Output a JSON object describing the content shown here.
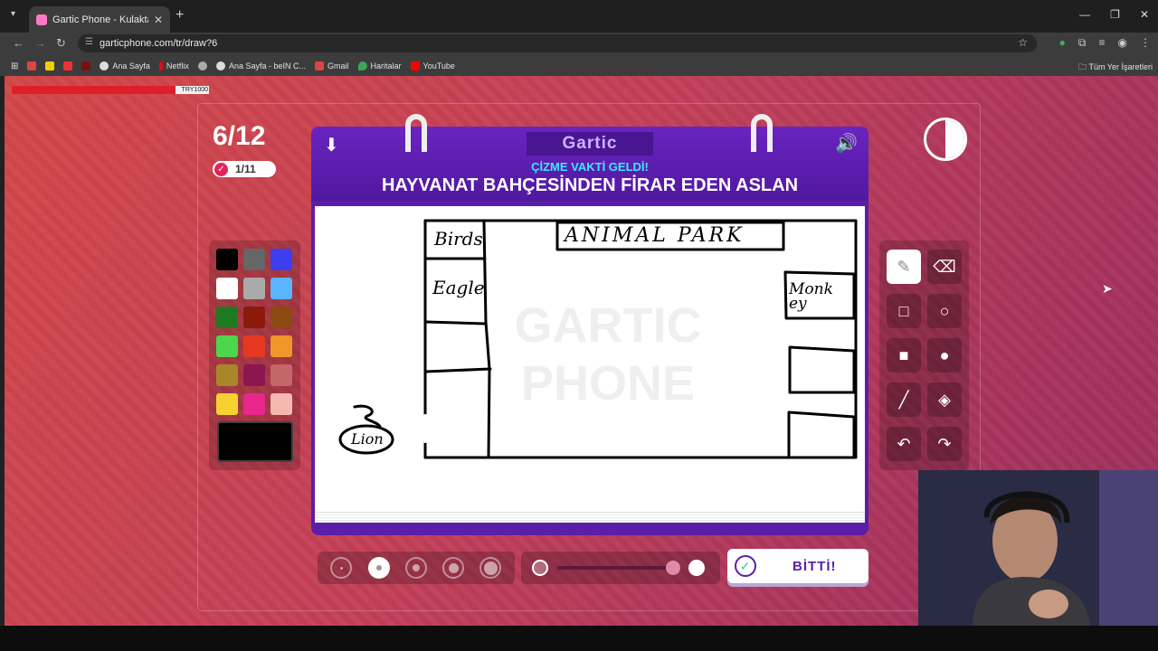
{
  "browser": {
    "tab_title": "Gartic Phone - Kulaktan Kulağa",
    "url": "garticphone.com/tr/draw?6",
    "bookmarks": [
      "Ana Sayfa",
      "Netflix",
      "Ana Sayfa - beIN C...",
      "Gmail",
      "Haritalar",
      "YouTube"
    ],
    "all_bookmarks": "Tüm Yer İşaretleri"
  },
  "stream_bar": {
    "value": "TRY1000",
    "progress": 0.83
  },
  "game": {
    "round": "6/12",
    "done_count": "1/11",
    "logo": "Gartic",
    "subtitle": "ÇİZME VAKTİ GELDİ!",
    "prompt": "HAYVANAT BAHÇESİNDEN FİRAR EDEN ASLAN",
    "done_button": "BİTTİ!"
  },
  "drawing": {
    "labels": [
      "Birds",
      "Eagle",
      "ANIMAL PARK",
      "Monk ey",
      "Lion"
    ]
  },
  "colors": {
    "palette": [
      "#000000",
      "#666666",
      "#3d3ef0",
      "#ffffff",
      "#aaaaaa",
      "#5ab4ff",
      "#1e7a1e",
      "#8b1a0a",
      "#8a4a12",
      "#4cd64c",
      "#e53922",
      "#f0962a",
      "#a8862a",
      "#8e1650",
      "#c4676a",
      "#f6cf30",
      "#e8268c",
      "#f5b8b0"
    ],
    "current": "#000000",
    "accent": "#5a1ea8"
  },
  "icons": {
    "download": "download-icon",
    "sound": "speaker-icon",
    "contrast": "contrast-icon",
    "done": "check-icon",
    "tools": [
      "pencil-icon",
      "eraser-icon",
      "rectangle-outline-icon",
      "circle-outline-icon",
      "rectangle-fill-icon",
      "circle-fill-icon",
      "line-icon",
      "bucket-icon",
      "undo-icon",
      "redo-icon"
    ]
  }
}
